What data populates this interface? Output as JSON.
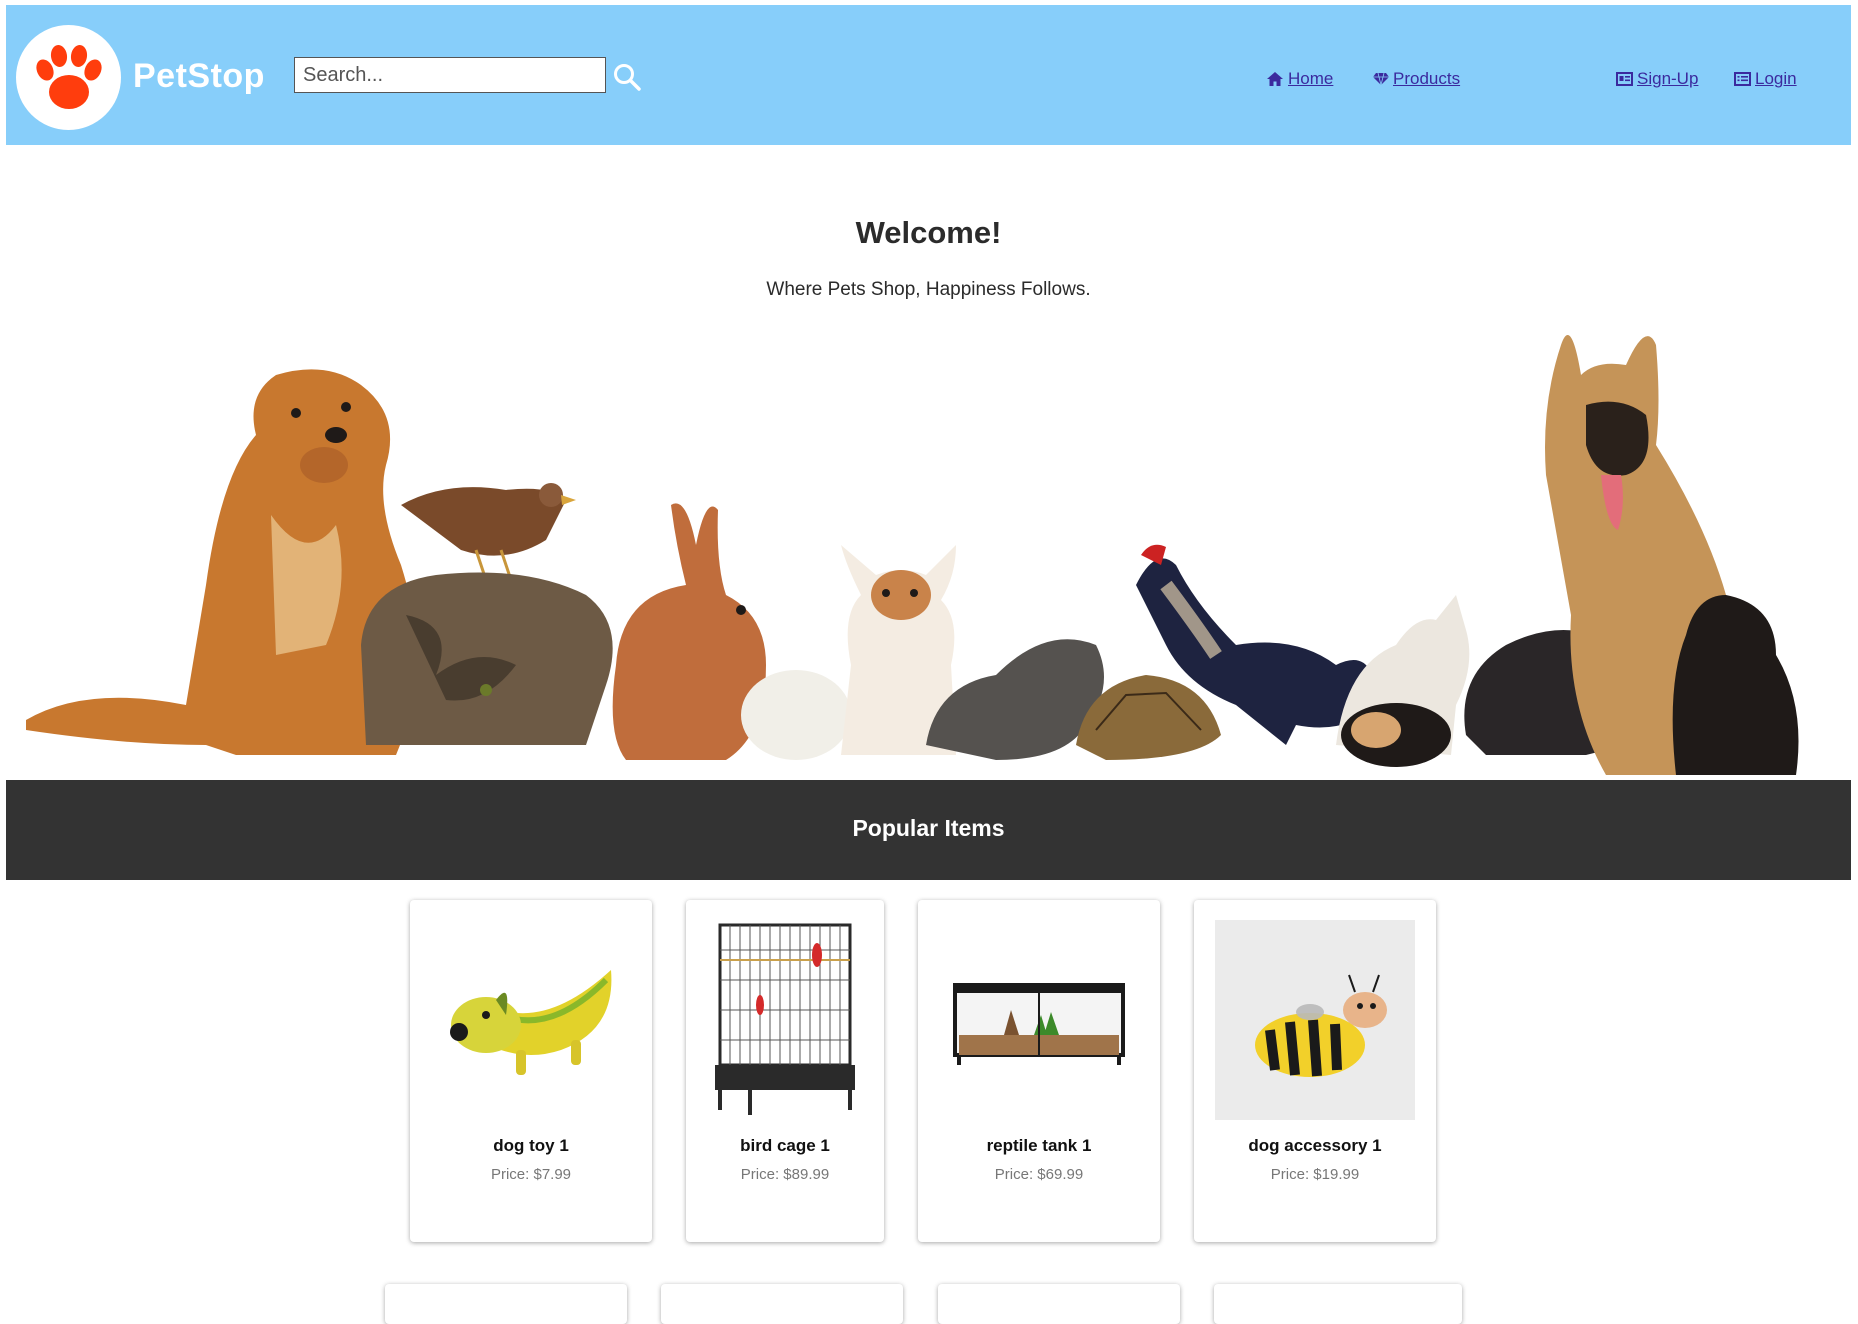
{
  "colors": {
    "header_bg": "#87cefa",
    "brand_text": "#ffffff",
    "logo_paw": "#ff3d0d",
    "nav_link": "#3b2a9e",
    "popular_bar_bg": "#333333",
    "price_text": "#777777"
  },
  "header": {
    "brand": "PetStop",
    "logo_icon": "paw-icon",
    "search": {
      "placeholder": "Search...",
      "value": "",
      "icon": "search-icon"
    },
    "nav": [
      {
        "label": "Home",
        "icon": "home-icon"
      },
      {
        "label": "Products",
        "icon": "gem-icon"
      }
    ],
    "account": [
      {
        "label": "Sign-Up",
        "icon": "id-card-icon"
      },
      {
        "label": "Login",
        "icon": "list-icon"
      }
    ]
  },
  "hero": {
    "title": "Welcome!",
    "subtitle": "Where Pets Shop, Happiness Follows."
  },
  "popular": {
    "heading": "Popular Items",
    "items": [
      {
        "name": "dog toy 1",
        "price": "Price: $7.99"
      },
      {
        "name": "bird cage 1",
        "price": "Price: $89.99"
      },
      {
        "name": "reptile tank 1",
        "price": "Price: $69.99"
      },
      {
        "name": "dog accessory 1",
        "price": "Price: $19.99"
      }
    ]
  }
}
